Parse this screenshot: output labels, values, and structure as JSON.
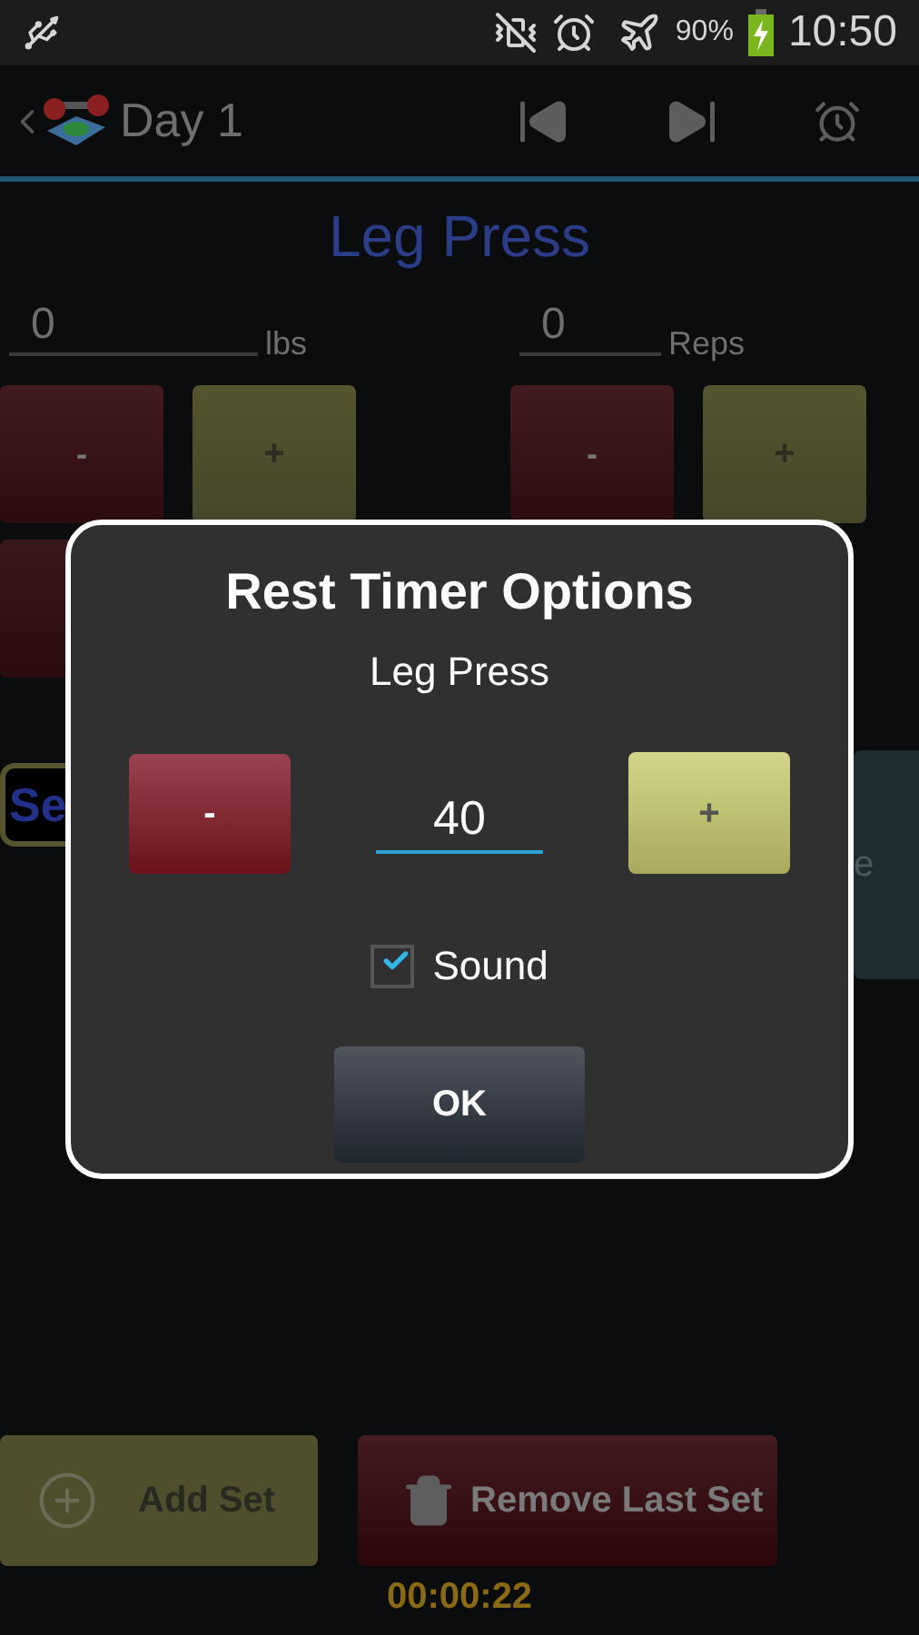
{
  "status_bar": {
    "battery": "90%",
    "time": "10:50"
  },
  "action_bar": {
    "title": "Day 1"
  },
  "exercise": {
    "title": "Leg Press",
    "fields": [
      {
        "value": "0",
        "unit": "lbs"
      },
      {
        "value": "0",
        "unit": "Reps"
      }
    ],
    "steppers": [
      {
        "minus": "-",
        "plus": "+"
      },
      {
        "minus": "-",
        "plus": "+"
      }
    ],
    "partial_button": "Se",
    "partial_side_button": "e"
  },
  "bottom": {
    "add_button": "Add Set",
    "remove_button": "Remove Last Set",
    "timer": "00:00:22"
  },
  "dialog": {
    "title": "Rest Timer Options",
    "subtitle": "Leg Press",
    "minus": "-",
    "value": "40",
    "plus": "+",
    "sound": {
      "label": "Sound",
      "checked": true
    },
    "ok": "OK"
  }
}
